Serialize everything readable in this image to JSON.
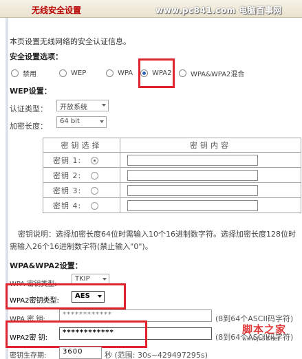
{
  "banner": {
    "title": "无线安全设置",
    "site": "www.pc841.com 电脑百事网"
  },
  "intro": "本页设置无线网络的安全认证信息。",
  "security_section": {
    "label": "安全设置选项：",
    "options": [
      {
        "label": "禁用",
        "selected": false
      },
      {
        "label": "WEP",
        "selected": false
      },
      {
        "label": "WPA",
        "selected": false
      },
      {
        "label": "WPA2",
        "selected": true
      },
      {
        "label": "WPA&WPA2混合",
        "selected": false
      }
    ]
  },
  "wep": {
    "label": "WEP设置：",
    "auth_label": "认证类型：",
    "auth_value": "开放系统",
    "length_label": "加密长度：",
    "length_value": "64 bit",
    "col_key_select": "密钥选择",
    "col_key_content": "密钥内容",
    "keys": [
      {
        "name": "密钥 1:",
        "selected": true
      },
      {
        "name": "密钥 2:",
        "selected": false
      },
      {
        "name": "密钥 3:",
        "selected": false
      },
      {
        "name": "密钥 4:",
        "selected": false
      }
    ],
    "note": "密钥说明：选择加密长度64位时需输入10个16进制数字符。选择加密长度128位时需输入26个16进制数字符(禁止输入\"0\")。"
  },
  "wpa": {
    "label": "WPA&WPA2设置：",
    "wpa_type_label": "WPA 密钥类型:",
    "wpa_type_value": "TKIP",
    "wpa2_type_label": "WPA2密钥类型:",
    "wpa2_type_value": "AES",
    "wpa_key_label": "WPA 密  钥:",
    "wpa_key_value": "************",
    "wpa_key_hint": "(8到64个ASCII码字符)",
    "wpa2_key_label": "WPA2密  钥:",
    "wpa2_key_value": "************",
    "wpa2_key_hint": "(8到64个ASCII码字符)",
    "lifetime_label": "密钥生存期:",
    "lifetime_value": "3600",
    "lifetime_hint": "秒 (范围: 30s~429497295s)"
  },
  "watermark": {
    "text": "脚本之家",
    "url": "www.jb51.net"
  },
  "colors": {
    "highlight": "#e0232c",
    "banner_title": "#b80000"
  }
}
